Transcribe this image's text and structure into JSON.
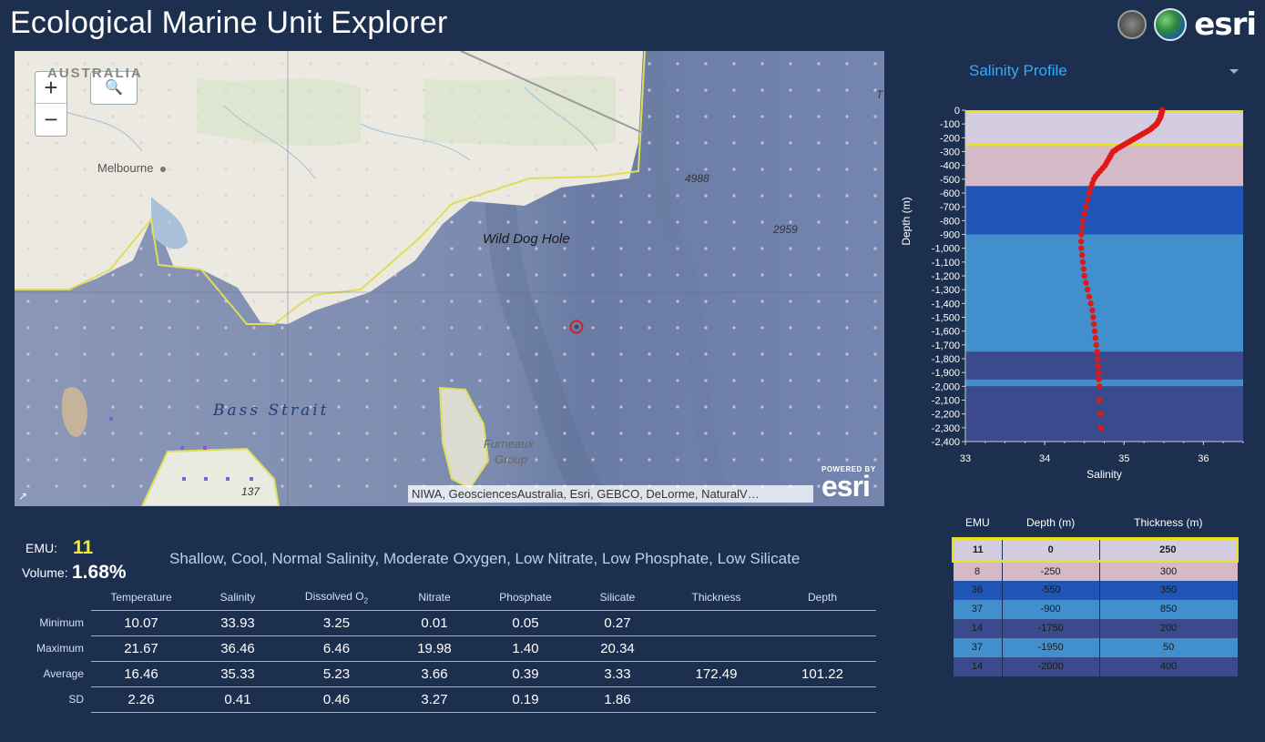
{
  "header": {
    "title": "Ecological Marine Unit Explorer",
    "logo_text": "esri"
  },
  "map": {
    "zoom_in_label": "+",
    "zoom_out_label": "−",
    "search_icon": "search-icon",
    "labels": {
      "australia": "AUSTRALIA",
      "melbourne": "Melbourne",
      "wild_dog_hole": "Wild Dog Hole",
      "bass_strait": "Bass Strait",
      "furneaux": "Furneaux",
      "group": "Group",
      "depth_4988": "4988",
      "depth_2959": "2959",
      "depth_137": "137",
      "edge_t": "T"
    },
    "attribution": "NIWA, GeosciencesAustralia, Esri, GEBCO, DeLorme, NaturalV…",
    "powered_by": "POWERED BY",
    "powered_logo": "esri"
  },
  "profile": {
    "selected": "Salinity Profile",
    "options": [
      "Salinity Profile"
    ]
  },
  "chart_data": {
    "type": "scatter",
    "xlabel": "Salinity",
    "ylabel": "Depth (m)",
    "xlim": [
      33,
      36.5
    ],
    "ylim": [
      -2400,
      0
    ],
    "x_ticks": [
      "33",
      "34",
      "35",
      "36"
    ],
    "y_ticks": [
      "0",
      "-100",
      "-200",
      "-300",
      "-400",
      "-500",
      "-600",
      "-700",
      "-800",
      "-900",
      "-1,000",
      "-1,100",
      "-1,200",
      "-1,300",
      "-1,400",
      "-1,500",
      "-1,600",
      "-1,700",
      "-1,800",
      "-1,900",
      "-2,000",
      "-2,100",
      "-2,200",
      "-2,300",
      "-2,400"
    ],
    "bands": [
      {
        "emu": "11",
        "top": 0,
        "bottom": -250,
        "color": "#d4cde2"
      },
      {
        "emu": "8",
        "top": -250,
        "bottom": -550,
        "color": "#d5b9c6"
      },
      {
        "emu": "36",
        "top": -550,
        "bottom": -900,
        "color": "#1f56b6"
      },
      {
        "emu": "37",
        "top": -900,
        "bottom": -1750,
        "color": "#418fcc"
      },
      {
        "emu": "14",
        "top": -1750,
        "bottom": -1950,
        "color": "#3a4a8c"
      },
      {
        "emu": "37",
        "top": -1950,
        "bottom": -2000,
        "color": "#418fcc"
      },
      {
        "emu": "14",
        "top": -2000,
        "bottom": -2400,
        "color": "#3a4a8c"
      }
    ],
    "highlight_band": 0,
    "point_color": "#e01818",
    "points": [
      [
        35.48,
        0
      ],
      [
        35.48,
        -10
      ],
      [
        35.47,
        -20
      ],
      [
        35.47,
        -30
      ],
      [
        35.46,
        -40
      ],
      [
        35.46,
        -50
      ],
      [
        35.45,
        -60
      ],
      [
        35.44,
        -70
      ],
      [
        35.43,
        -80
      ],
      [
        35.42,
        -90
      ],
      [
        35.41,
        -100
      ],
      [
        35.39,
        -110
      ],
      [
        35.37,
        -120
      ],
      [
        35.35,
        -130
      ],
      [
        35.33,
        -140
      ],
      [
        35.3,
        -150
      ],
      [
        35.27,
        -160
      ],
      [
        35.24,
        -170
      ],
      [
        35.21,
        -180
      ],
      [
        35.18,
        -190
      ],
      [
        35.15,
        -200
      ],
      [
        35.12,
        -210
      ],
      [
        35.09,
        -220
      ],
      [
        35.06,
        -230
      ],
      [
        35.03,
        -240
      ],
      [
        35.0,
        -250
      ],
      [
        34.97,
        -260
      ],
      [
        34.94,
        -270
      ],
      [
        34.91,
        -280
      ],
      [
        34.89,
        -290
      ],
      [
        34.86,
        -300
      ],
      [
        34.84,
        -320
      ],
      [
        34.82,
        -340
      ],
      [
        34.8,
        -360
      ],
      [
        34.78,
        -380
      ],
      [
        34.76,
        -400
      ],
      [
        34.73,
        -420
      ],
      [
        34.7,
        -440
      ],
      [
        34.67,
        -460
      ],
      [
        34.64,
        -480
      ],
      [
        34.62,
        -500
      ],
      [
        34.6,
        -530
      ],
      [
        34.58,
        -560
      ],
      [
        34.56,
        -600
      ],
      [
        34.54,
        -650
      ],
      [
        34.52,
        -700
      ],
      [
        34.5,
        -750
      ],
      [
        34.48,
        -800
      ],
      [
        34.47,
        -850
      ],
      [
        34.46,
        -900
      ],
      [
        34.46,
        -950
      ],
      [
        34.46,
        -1000
      ],
      [
        34.47,
        -1050
      ],
      [
        34.48,
        -1100
      ],
      [
        34.49,
        -1150
      ],
      [
        34.5,
        -1200
      ],
      [
        34.52,
        -1250
      ],
      [
        34.54,
        -1300
      ],
      [
        34.56,
        -1350
      ],
      [
        34.58,
        -1400
      ],
      [
        34.6,
        -1450
      ],
      [
        34.61,
        -1500
      ],
      [
        34.62,
        -1550
      ],
      [
        34.63,
        -1600
      ],
      [
        34.64,
        -1650
      ],
      [
        34.65,
        -1700
      ],
      [
        34.66,
        -1750
      ],
      [
        34.67,
        -1800
      ],
      [
        34.67,
        -1850
      ],
      [
        34.68,
        -1900
      ],
      [
        34.68,
        -1950
      ],
      [
        34.69,
        -2000
      ],
      [
        34.69,
        -2100
      ],
      [
        34.7,
        -2200
      ],
      [
        34.71,
        -2300
      ]
    ]
  },
  "emu_table": {
    "headers": [
      "EMU",
      "Depth (m)",
      "Thickness (m)"
    ],
    "rows": [
      {
        "emu": "11",
        "depth": "0",
        "thickness": "250",
        "color": "#d4cde2",
        "selected": true
      },
      {
        "emu": "8",
        "depth": "-250",
        "thickness": "300",
        "color": "#d5b9c6",
        "selected": false
      },
      {
        "emu": "36",
        "depth": "-550",
        "thickness": "350",
        "color": "#1f56b6",
        "selected": false
      },
      {
        "emu": "37",
        "depth": "-900",
        "thickness": "850",
        "color": "#418fcc",
        "selected": false
      },
      {
        "emu": "14",
        "depth": "-1750",
        "thickness": "200",
        "color": "#3a4a8c",
        "selected": false
      },
      {
        "emu": "37",
        "depth": "-1950",
        "thickness": "50",
        "color": "#418fcc",
        "selected": false
      },
      {
        "emu": "14",
        "depth": "-2000",
        "thickness": "400",
        "color": "#3a4a8c",
        "selected": false
      }
    ]
  },
  "emu_info": {
    "emu_label": "EMU:",
    "emu_value": "11",
    "volume_label": "Volume:",
    "volume_value": "1.68%",
    "description": "Shallow, Cool, Normal Salinity, Moderate Oxygen, Low Nitrate, Low Phosphate, Low Silicate"
  },
  "stats": {
    "headers": [
      "Temperature",
      "Salinity",
      "Dissolved O",
      "Nitrate",
      "Phosphate",
      "Silicate",
      "Thickness",
      "Depth"
    ],
    "o2_sub": "2",
    "rows": [
      {
        "label": "Minimum",
        "values": [
          "10.07",
          "33.93",
          "3.25",
          "0.01",
          "0.05",
          "0.27",
          "",
          ""
        ]
      },
      {
        "label": "Maximum",
        "values": [
          "21.67",
          "36.46",
          "6.46",
          "19.98",
          "1.40",
          "20.34",
          "",
          ""
        ]
      },
      {
        "label": "Average",
        "values": [
          "16.46",
          "35.33",
          "5.23",
          "3.66",
          "0.39",
          "3.33",
          "172.49",
          "101.22"
        ]
      },
      {
        "label": "SD",
        "values": [
          "2.26",
          "0.41",
          "0.46",
          "3.27",
          "0.19",
          "1.86",
          "",
          ""
        ]
      }
    ]
  }
}
